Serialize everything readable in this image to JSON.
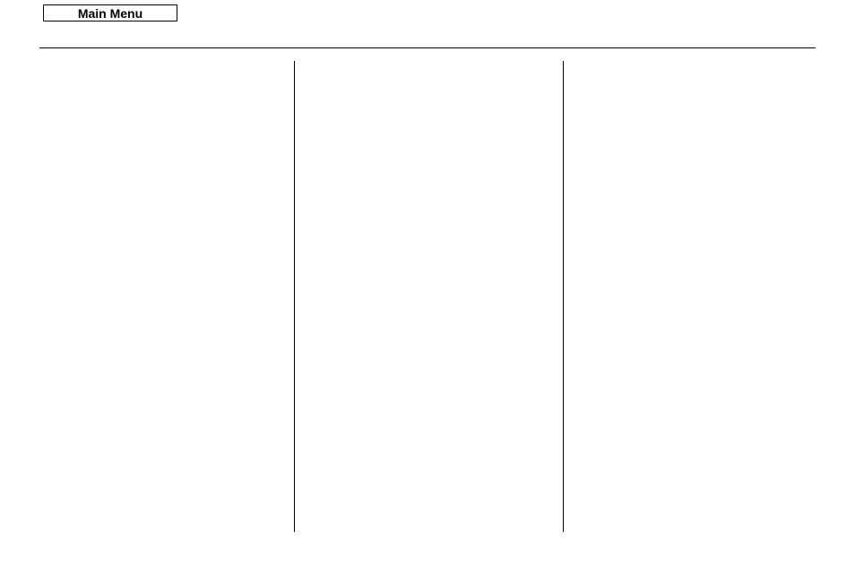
{
  "toolbar": {
    "main_menu_label": "Main Menu"
  }
}
